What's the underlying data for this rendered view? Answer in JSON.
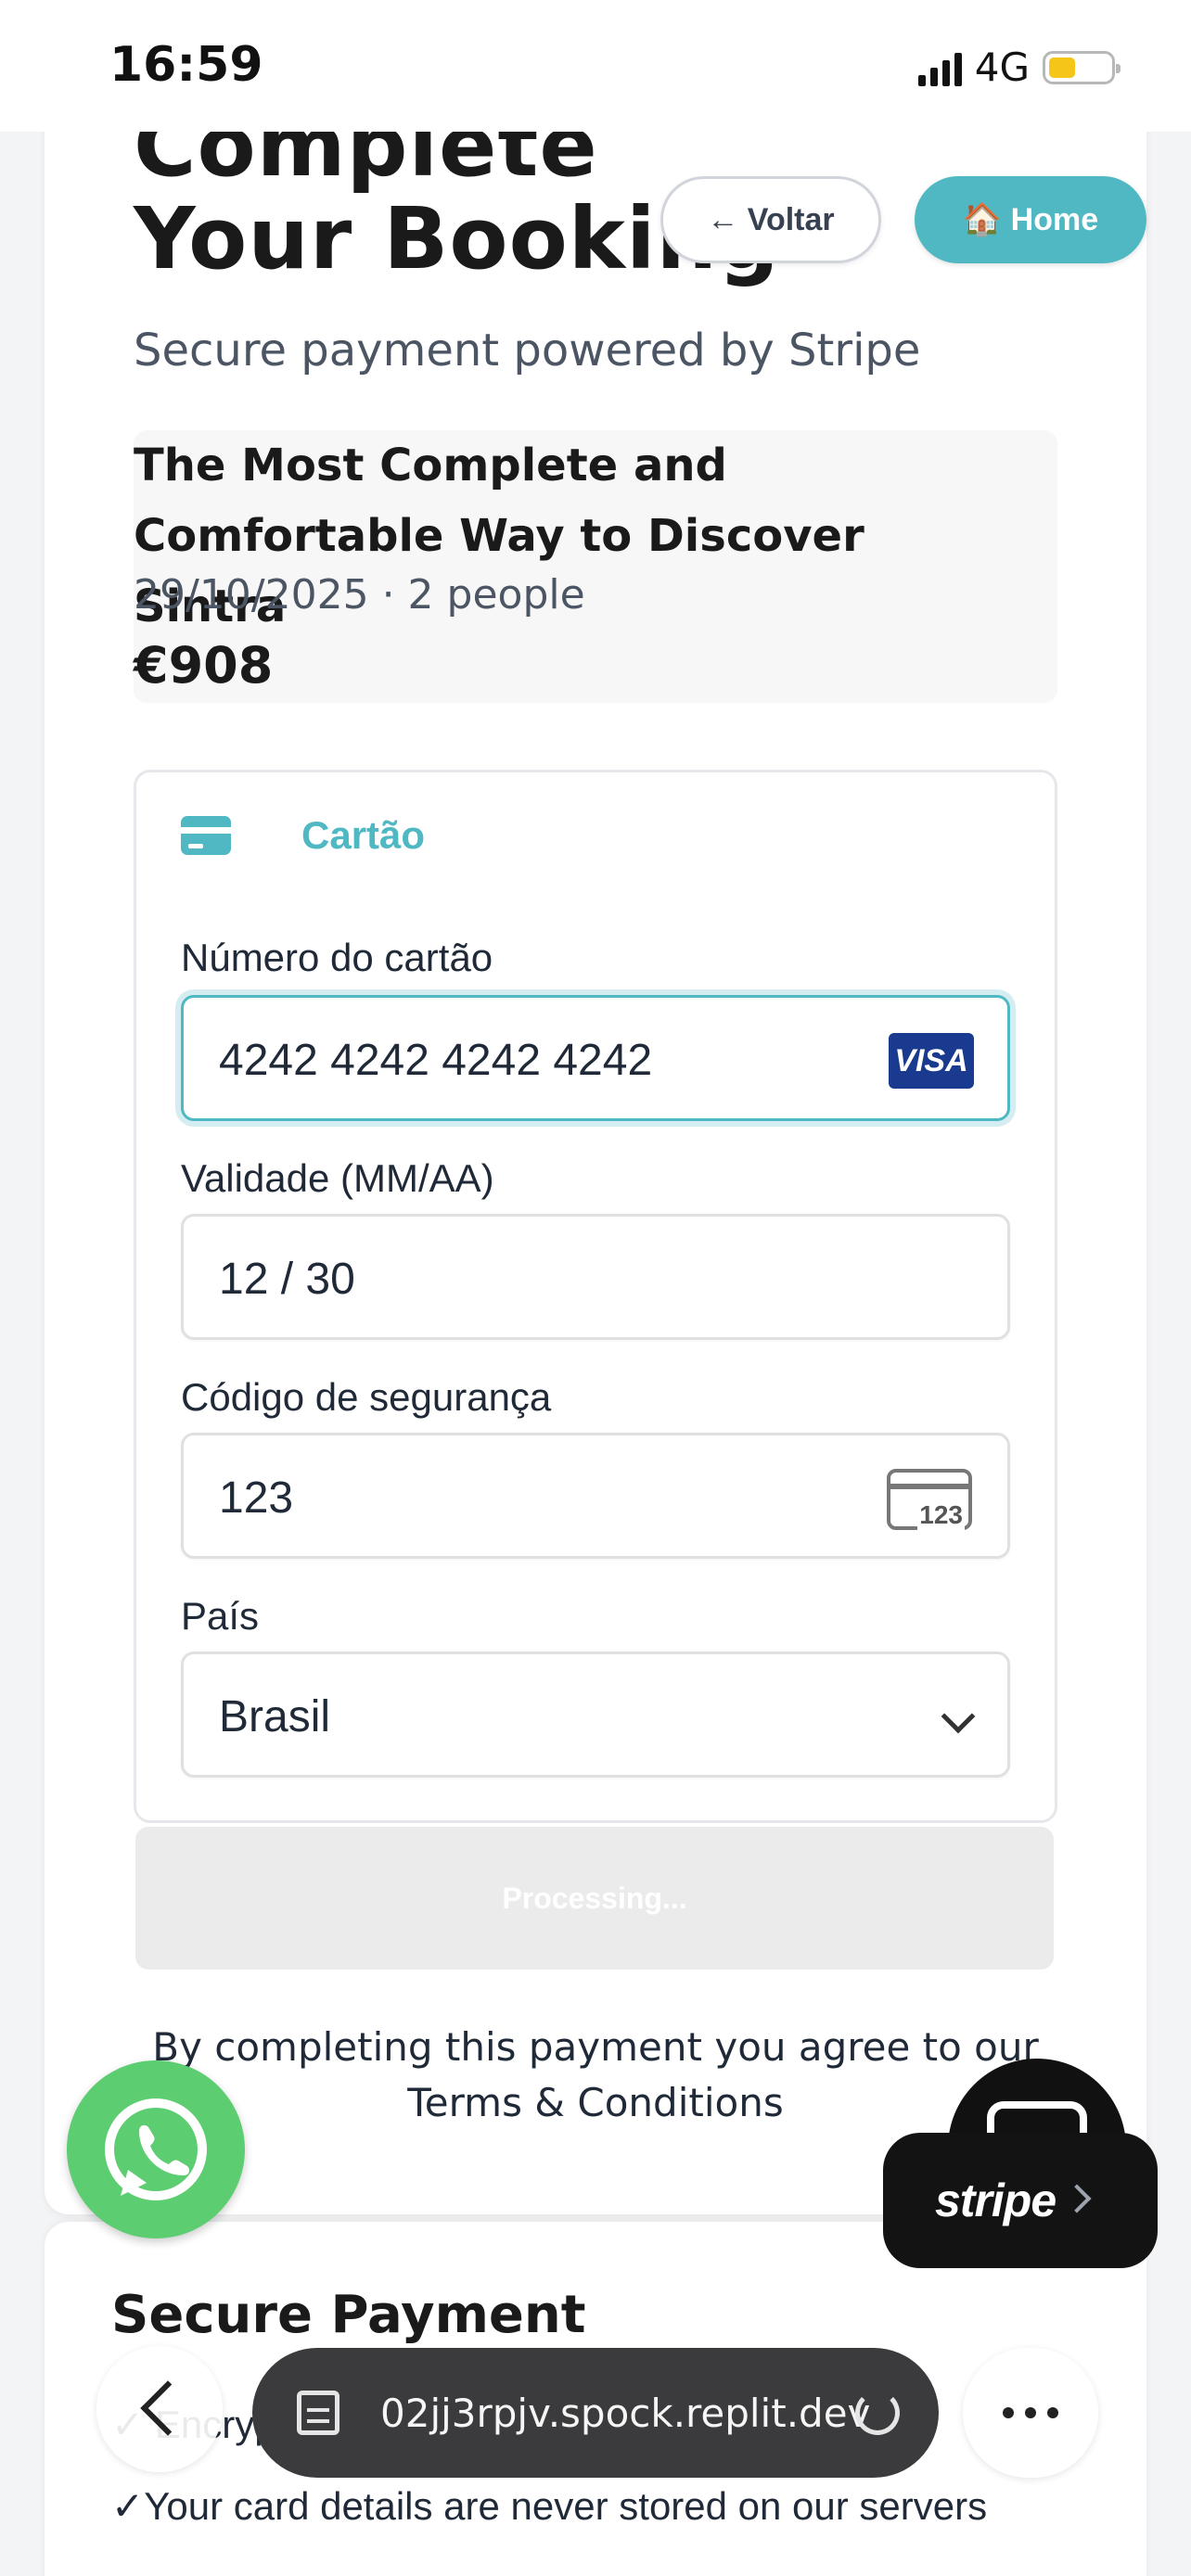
{
  "status_bar": {
    "time": "16:59",
    "network": "4G"
  },
  "header": {
    "title": "Complete Your Booking",
    "subtitle": "Secure payment powered by Stripe",
    "back_button": "← Voltar",
    "home_button": "🏠 Home"
  },
  "booking_summary": {
    "tour_title": "The Most Complete and Comfortable Way to Discover Sintra",
    "meta": "29/10/2025 · 2 people",
    "price": "€908"
  },
  "payment_form": {
    "method_tab": "Cartão",
    "card_number_label": "Número do cartão",
    "card_number_value": "4242 4242 4242 4242",
    "card_brand": "VISA",
    "expiry_label": "Validade (MM/AA)",
    "expiry_value": "12 / 30",
    "cvc_label": "Código de segurança",
    "cvc_value": "123",
    "cvc_icon_text": "123",
    "country_label": "País",
    "country_value": "Brasil",
    "submit_button": "Processing..."
  },
  "terms": {
    "line1": "By completing this payment you agree to our",
    "line2": "Terms & Conditions"
  },
  "stripe_badge": {
    "label": "stripe"
  },
  "secure_payment": {
    "title": "Secure Payment",
    "item_partial": "✓ Encrypted",
    "item_stored": "✓Your card details are never stored on our servers"
  },
  "browser": {
    "url": "02jj3rpjv.spock.replit.dev"
  },
  "colors": {
    "accent": "#4fb8c3",
    "whatsapp": "#5dcd71",
    "visa": "#1a3a8f"
  },
  "icons": [
    "card-icon",
    "visa-logo",
    "cvc-card-icon",
    "chevron-down-icon",
    "whatsapp-icon",
    "chat-icon",
    "back-icon",
    "tabs-icon",
    "reload-icon",
    "more-icon"
  ]
}
